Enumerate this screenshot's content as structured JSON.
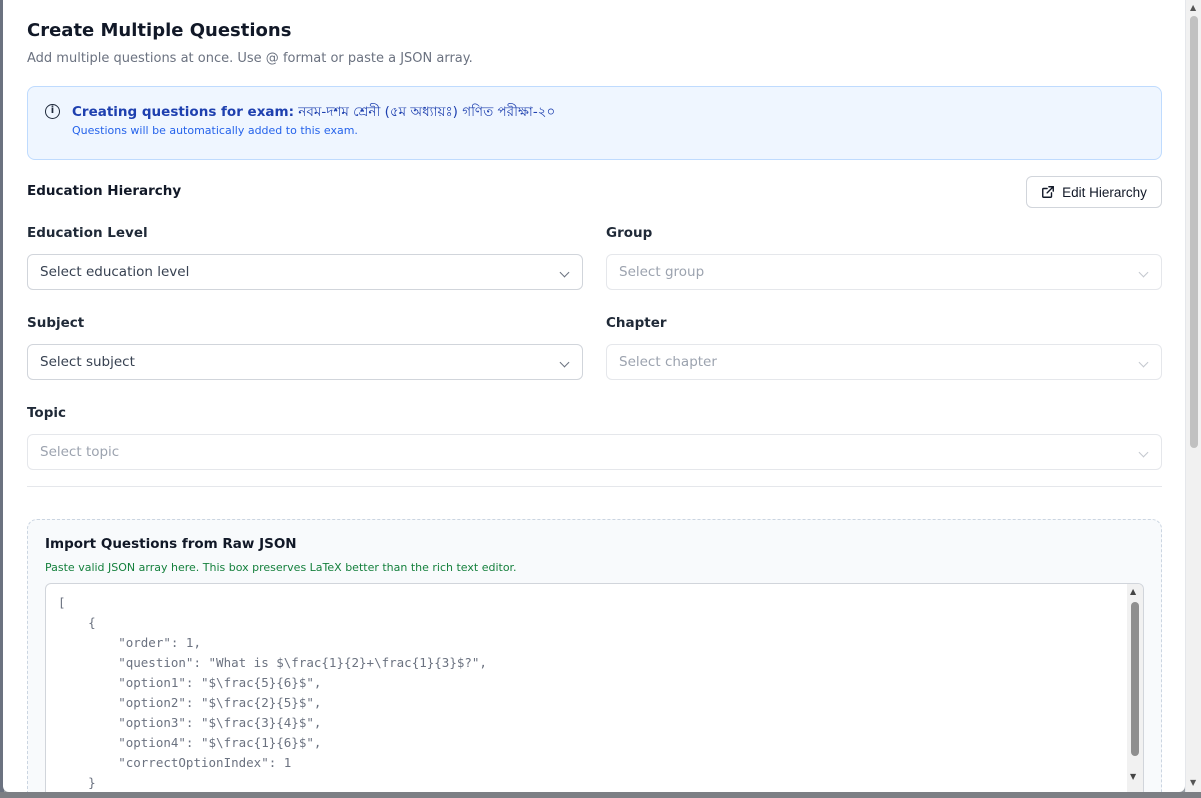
{
  "modal": {
    "title": "Create Multiple Questions",
    "subtitle": "Add multiple questions at once. Use @ format or paste a JSON array."
  },
  "info": {
    "icon": "info-icon",
    "label": "Creating questions for exam:",
    "exam_name": "নবম-দশম শ্রেনী (৫ম অধ্যায়ঃ) গণিত পরীক্ষা-২০",
    "note": "Questions will be automatically added to this exam."
  },
  "hierarchy": {
    "heading": "Education Hierarchy",
    "edit_button": "Edit Hierarchy",
    "edit_icon": "external-link-icon",
    "fields": {
      "education_level": {
        "label": "Education Level",
        "placeholder": "Select education level"
      },
      "group": {
        "label": "Group",
        "placeholder": "Select group"
      },
      "subject": {
        "label": "Subject",
        "placeholder": "Select subject"
      },
      "chapter": {
        "label": "Chapter",
        "placeholder": "Select chapter"
      },
      "topic": {
        "label": "Topic",
        "placeholder": "Select topic"
      }
    }
  },
  "import": {
    "title": "Import Questions from Raw JSON",
    "help": "Paste valid JSON array here. This box preserves LaTeX better than the rich text editor.",
    "content": "[\n    {\n        \"order\": 1,\n        \"question\": \"What is $\\frac{1}{2}+\\frac{1}{3}$?\",\n        \"option1\": \"$\\frac{5}{6}$\",\n        \"option2\": \"$\\frac{2}{5}$\",\n        \"option3\": \"$\\frac{3}{4}$\",\n        \"option4\": \"$\\frac{1}{6}$\",\n        \"correctOptionIndex\": 1\n    }"
  },
  "colors": {
    "info_bg": "#eff6ff",
    "info_text": "#1e40af",
    "help_text": "#15803d"
  }
}
